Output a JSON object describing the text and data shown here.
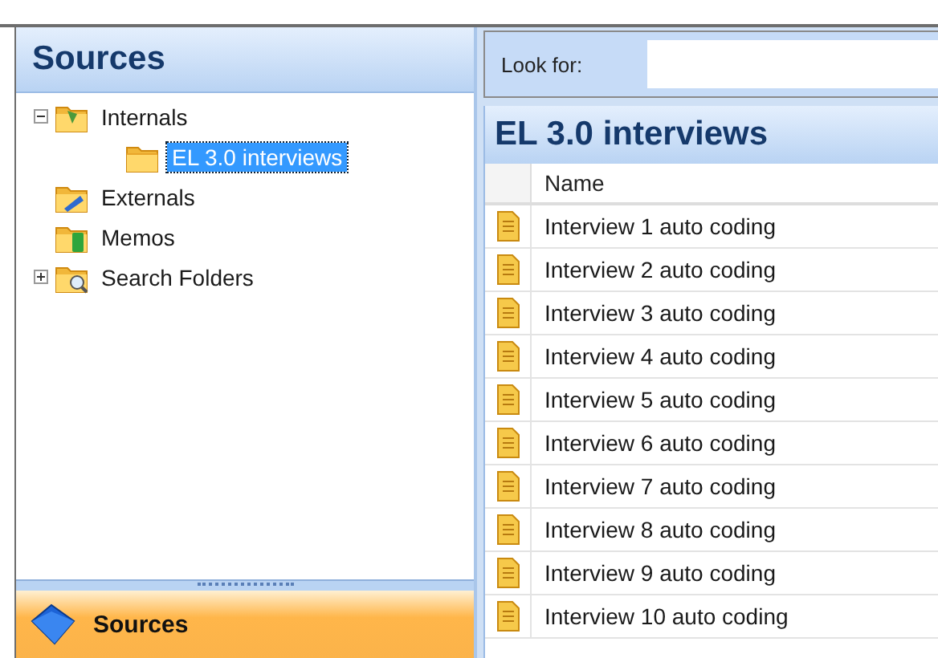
{
  "navigation": {
    "title": "Sources",
    "tree": [
      {
        "label": "Internals",
        "kind": "internals",
        "expanded": true,
        "selected": false,
        "children": [
          {
            "label": "EL 3.0 interviews",
            "kind": "plain",
            "selected": true
          }
        ]
      },
      {
        "label": "Externals",
        "kind": "externals",
        "selected": false
      },
      {
        "label": "Memos",
        "kind": "memos",
        "selected": false
      },
      {
        "label": "Search Folders",
        "kind": "search",
        "expanded": false,
        "selected": false
      }
    ],
    "button": {
      "label": "Sources"
    }
  },
  "search": {
    "label": "Look for:"
  },
  "list": {
    "title": "EL 3.0 interviews",
    "columns": [
      "Name"
    ],
    "rows": [
      {
        "name": "Interview 1 auto coding"
      },
      {
        "name": "Interview 2 auto coding"
      },
      {
        "name": "Interview 3 auto coding"
      },
      {
        "name": "Interview 4 auto coding"
      },
      {
        "name": "Interview 5 auto coding"
      },
      {
        "name": "Interview 6 auto coding"
      },
      {
        "name": "Interview 7 auto coding"
      },
      {
        "name": "Interview 8 auto coding"
      },
      {
        "name": "Interview 9 auto coding"
      },
      {
        "name": "Interview 10 auto coding"
      }
    ]
  }
}
